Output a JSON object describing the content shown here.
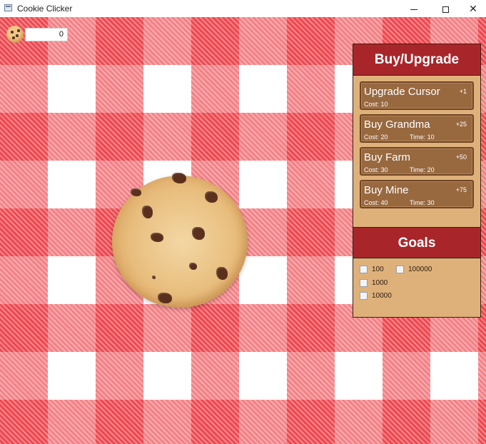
{
  "window": {
    "title": "Cookie Clicker"
  },
  "counter": {
    "value": "0"
  },
  "panel": {
    "buy_title": "Buy/Upgrade",
    "goals_title": "Goals",
    "items": [
      {
        "name": "Upgrade Cursor",
        "gain": "+1",
        "cost": "Cost: 10",
        "time": ""
      },
      {
        "name": "Buy Grandma",
        "gain": "+25",
        "cost": "Cost: 20",
        "time": "Time: 10"
      },
      {
        "name": "Buy Farm",
        "gain": "+50",
        "cost": "Cost: 30",
        "time": "Time: 20"
      },
      {
        "name": "Buy Mine",
        "gain": "+75",
        "cost": "Cost: 40",
        "time": "Time: 30"
      }
    ],
    "goals": [
      {
        "label": "100",
        "checked": false
      },
      {
        "label": "100000",
        "checked": false
      },
      {
        "label": "1000",
        "checked": false
      },
      {
        "label": "10000",
        "checked": false
      }
    ]
  },
  "colors": {
    "tablecloth_red": "#ea1923",
    "panel_bg": "#dfb17a",
    "header_red": "#a8262a",
    "button_brown": "#98683f"
  },
  "icons": [
    "app-window-icon",
    "minimize-icon",
    "maximize-icon",
    "close-icon",
    "cookie-icon"
  ]
}
